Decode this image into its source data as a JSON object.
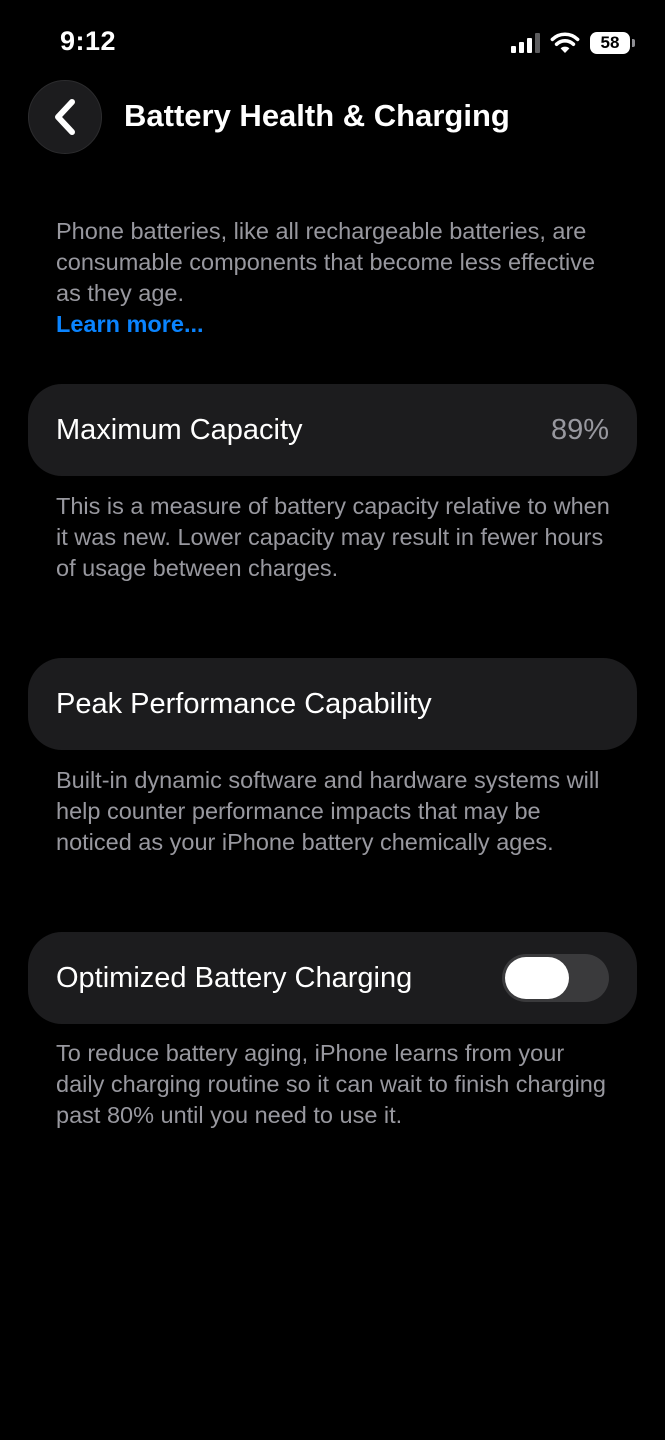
{
  "status_bar": {
    "time": "9:12",
    "battery_level": "58",
    "icons": [
      "cellular-signal-icon",
      "wifi-icon",
      "battery-icon"
    ]
  },
  "nav": {
    "back_icon": "chevron-left-icon",
    "title": "Battery Health & Charging"
  },
  "intro": {
    "text": "Phone batteries, like all rechargeable batteries, are consumable components that become less effective as they age.",
    "link": "Learn more..."
  },
  "maximum_capacity": {
    "label": "Maximum Capacity",
    "value": "89%",
    "footnote": "This is a measure of battery capacity relative to when it was new. Lower capacity may result in fewer hours of usage between charges."
  },
  "peak_performance": {
    "label": "Peak Performance Capability",
    "footnote": "Built-in dynamic software and hardware systems will help counter performance impacts that may be noticed as your iPhone battery chemically ages."
  },
  "optimized_charging": {
    "label": "Optimized Battery Charging",
    "enabled": false,
    "footnote": "To reduce battery aging, iPhone learns from your daily charging routine so it can wait to finish charging past 80% until you need to use it."
  },
  "colors": {
    "background": "#000000",
    "card": "#1c1c1e",
    "secondary_text": "#98989f",
    "link": "#0a84ff",
    "toggle_off": "#3a3a3c"
  }
}
